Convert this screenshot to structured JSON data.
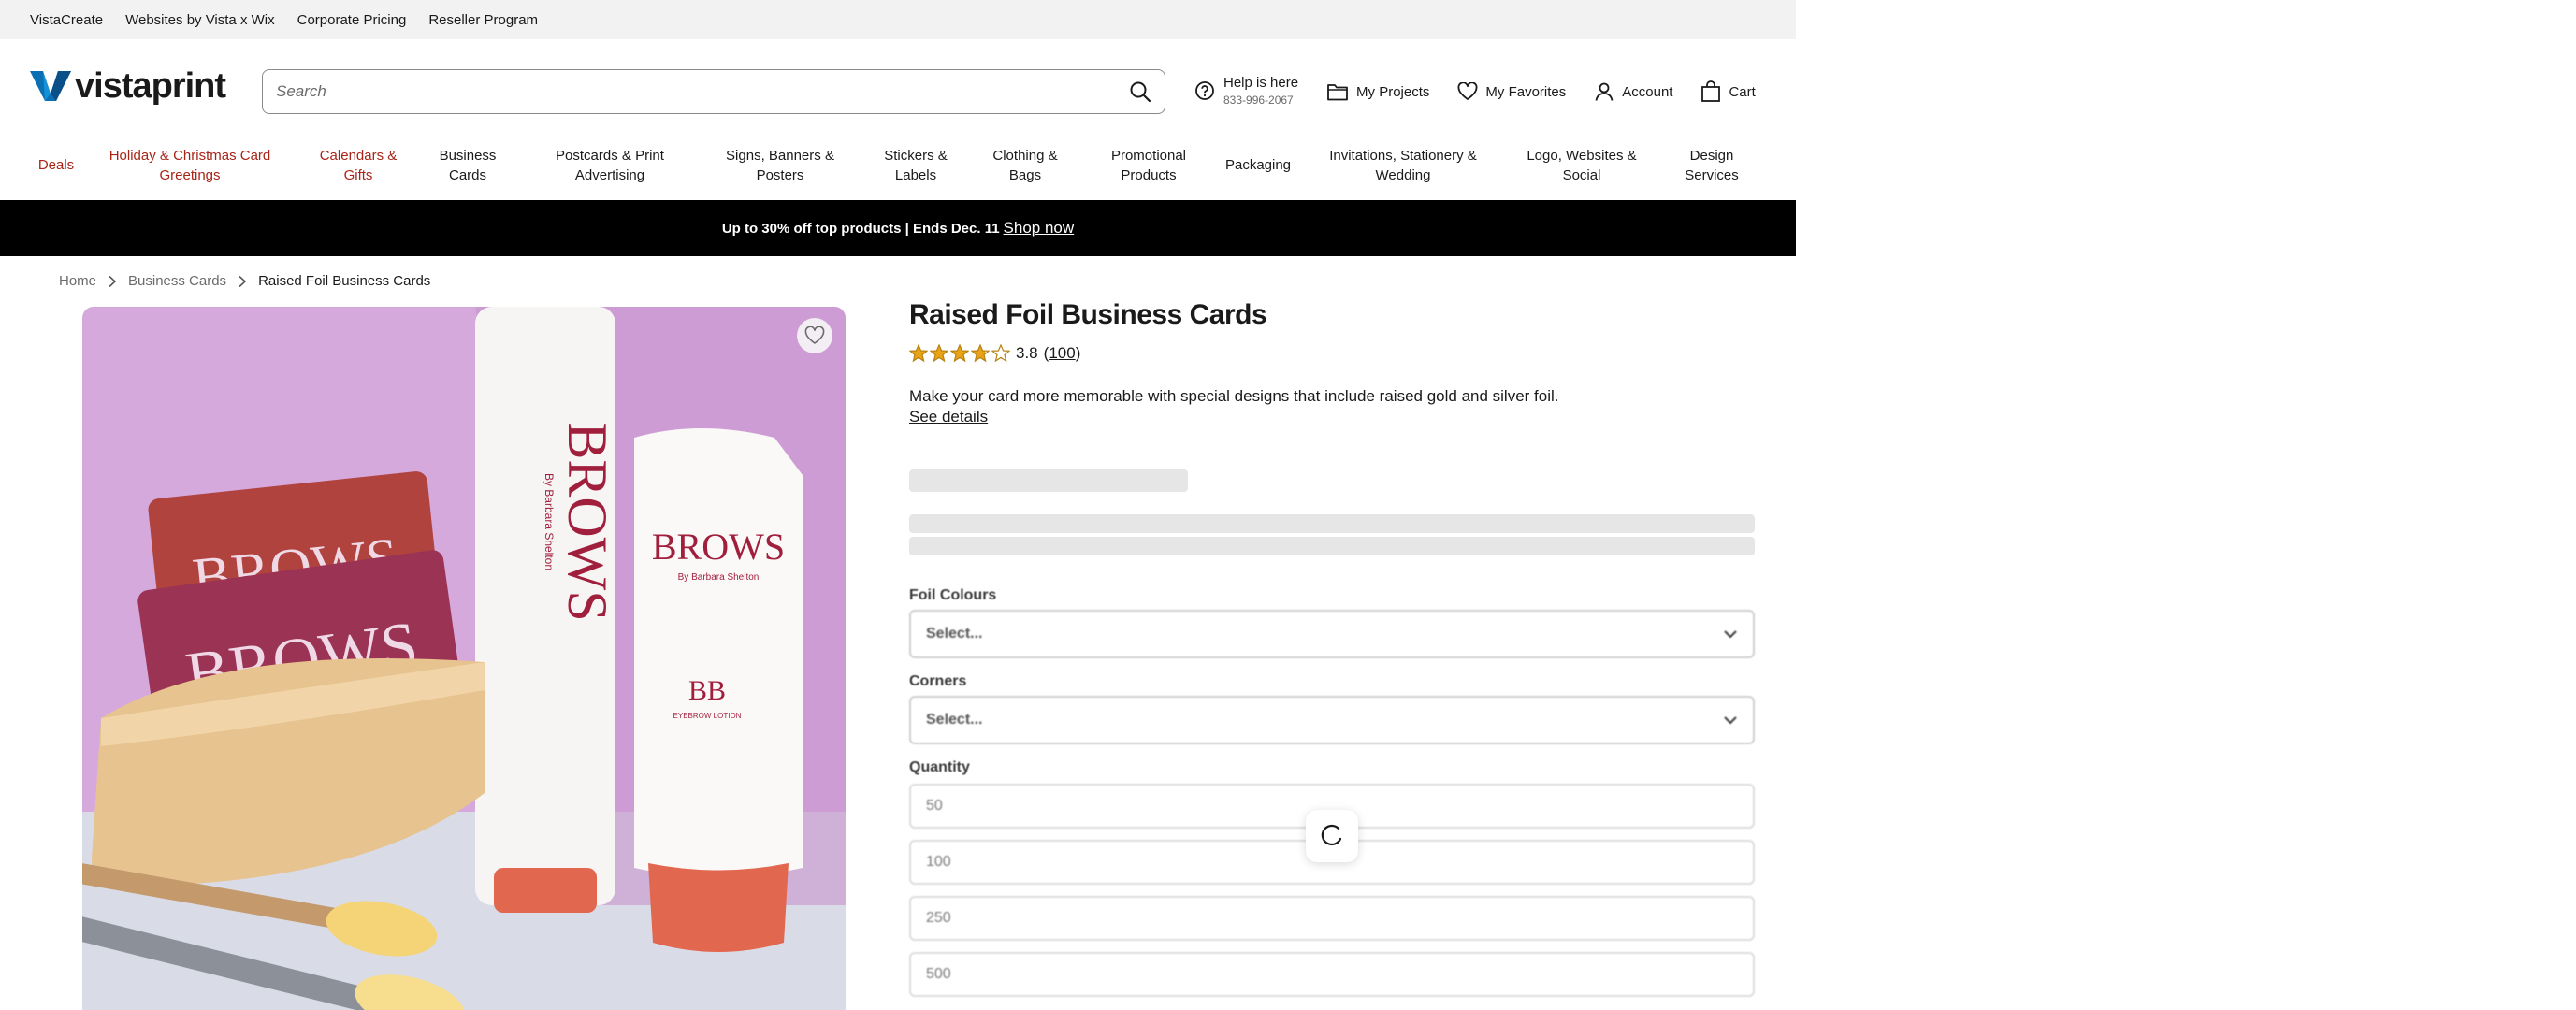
{
  "utility_links": [
    "VistaCreate",
    "Websites by Vista x Wix",
    "Corporate Pricing",
    "Reseller Program"
  ],
  "header": {
    "logo_text": "vistaprint",
    "search_placeholder": "Search",
    "help_title": "Help is here",
    "help_phone": "833-996-2067",
    "my_projects": "My Projects",
    "my_favorites": "My Favorites",
    "account": "Account",
    "cart": "Cart"
  },
  "nav": {
    "deals": "Deals",
    "holiday": "Holiday & Christmas Card Greetings",
    "calendars": "Calendars & Gifts",
    "business_cards": "Business Cards",
    "postcards": "Postcards & Print Advertising",
    "signs": "Signs, Banners & Posters",
    "stickers": "Stickers & Labels",
    "clothing": "Clothing & Bags",
    "promotional": "Promotional Products",
    "packaging": "Packaging",
    "invitations": "Invitations, Stationery & Wedding",
    "logo_websites": "Logo, Websites & Social",
    "design_services": "Design Services"
  },
  "promo": {
    "text": "Up to 30% off top products | Ends Dec. 11",
    "link": "Shop now"
  },
  "breadcrumb": {
    "home": "Home",
    "category": "Business Cards",
    "current": "Raised Foil Business Cards"
  },
  "product": {
    "title": "Raised Foil Business Cards",
    "rating_value": "3.8",
    "rating_stars": 3.8,
    "review_count": "100",
    "description": "Make your card more memorable with special designs that include raised gold and silver foil.",
    "see_details": "See details",
    "image_text": {
      "brand": "BROWS",
      "byline": "By Barbara Shelton",
      "lotion": "EYEBROW LOTION",
      "monogram": "BB"
    }
  },
  "options": {
    "foil_label": "Foil Colours",
    "foil_value": "Select...",
    "corners_label": "Corners",
    "corners_value": "Select...",
    "quantity_label": "Quantity",
    "quantities": [
      "50",
      "100",
      "250",
      "500"
    ]
  },
  "colors": {
    "nav_red": "#a82418",
    "promo_bg": "#000000",
    "hero_bg": "#d6a9dc"
  }
}
